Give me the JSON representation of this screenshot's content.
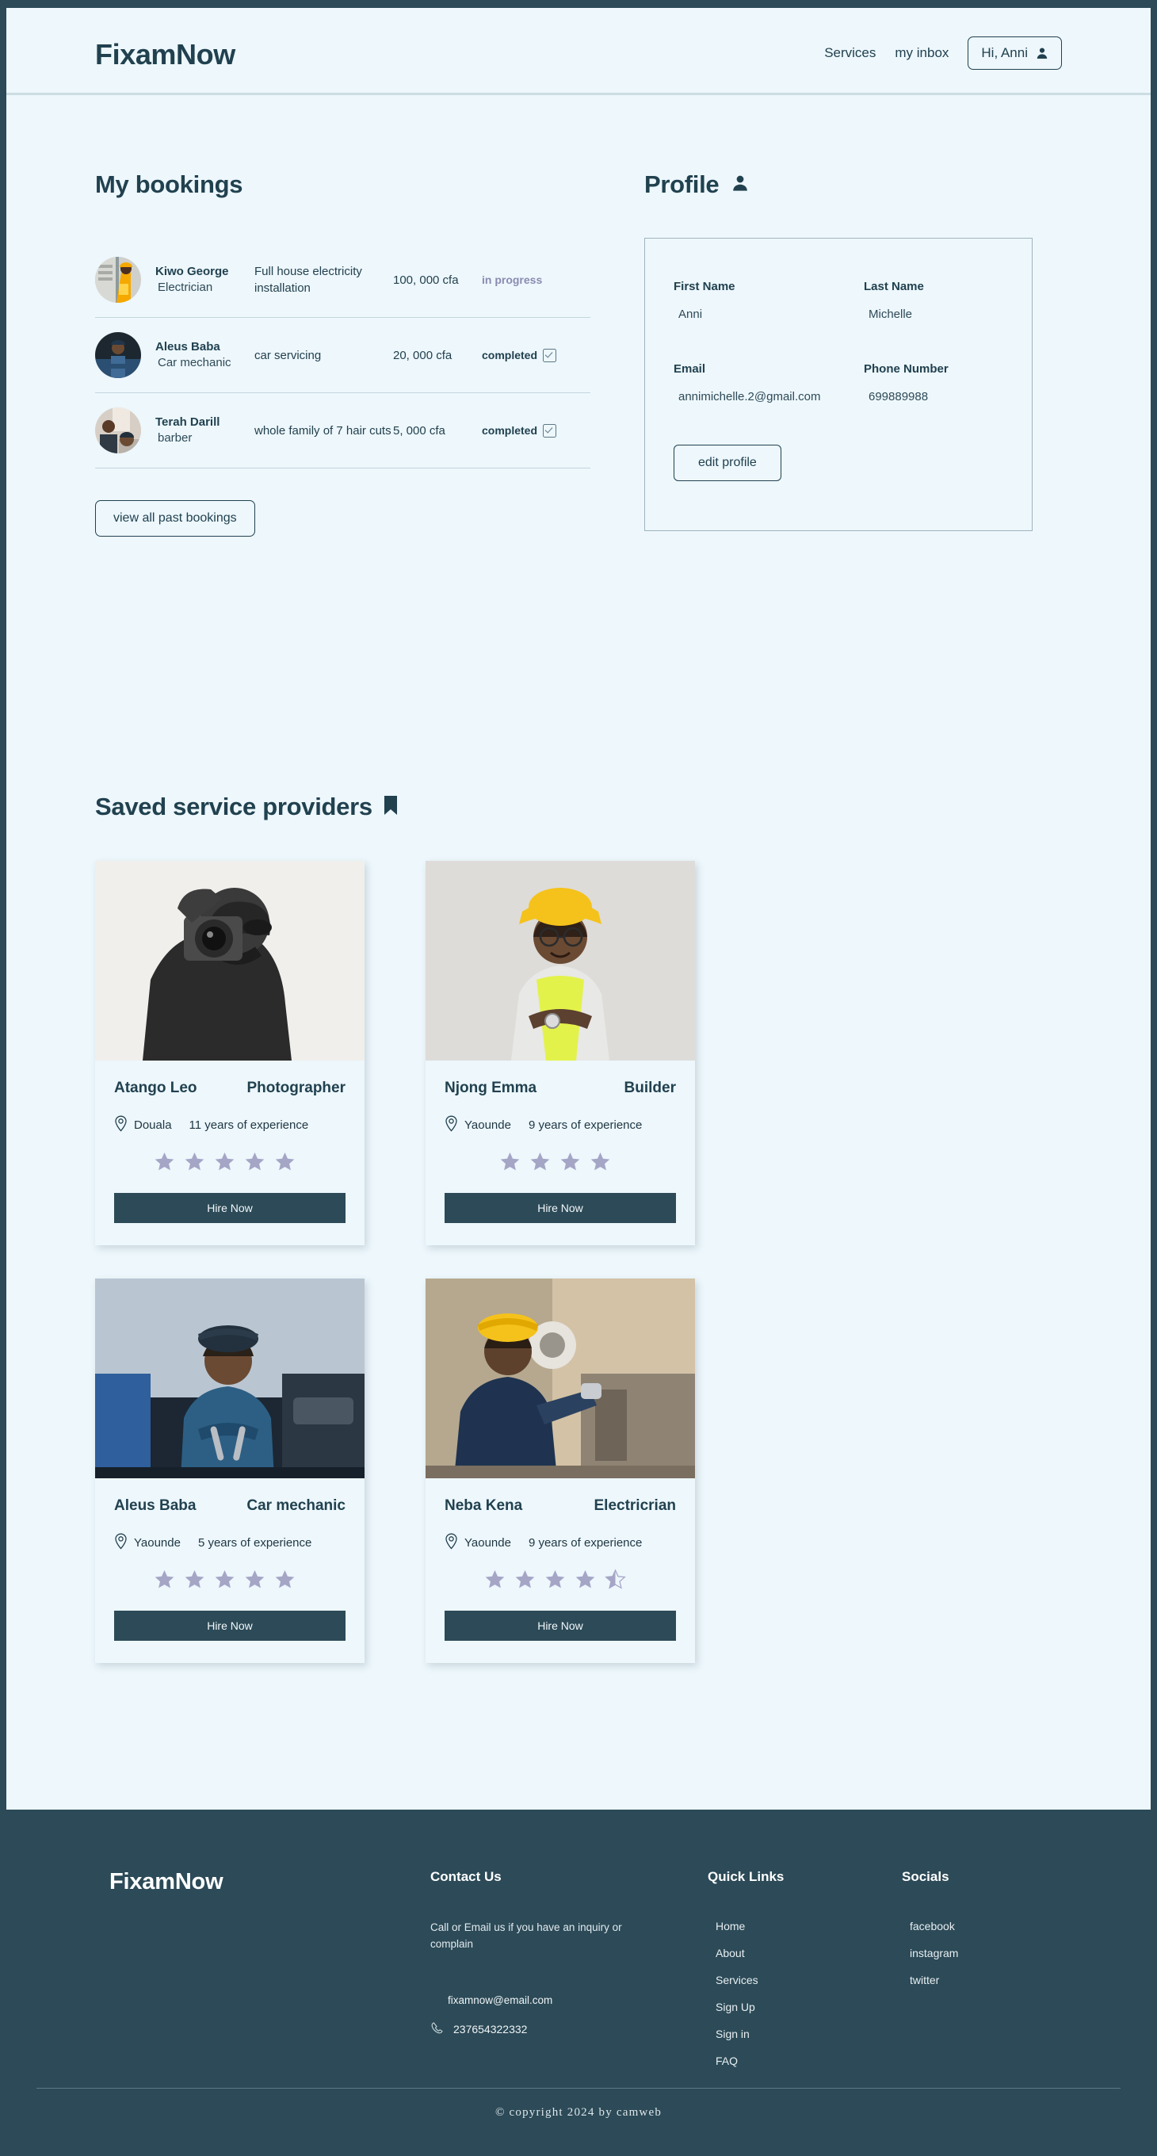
{
  "header": {
    "brand": "FixamNow",
    "nav": [
      {
        "label": "Services",
        "name": "nav-services"
      },
      {
        "label": "my inbox",
        "name": "nav-my-inbox"
      }
    ],
    "user_chip": "Hi, Anni"
  },
  "bookings": {
    "title": "My bookings",
    "rows": [
      {
        "name": "Kiwo George",
        "role": "Electrician",
        "service": "Full house electricity installation",
        "price": "100, 000 cfa",
        "status": "in progress",
        "status_type": "inprogress"
      },
      {
        "name": "Aleus Baba",
        "role": "Car mechanic",
        "service": "car servicing",
        "price": "20, 000 cfa",
        "status": "completed",
        "status_type": "completed"
      },
      {
        "name": "Terah Darill",
        "role": "barber",
        "service": "whole family of 7 hair cuts",
        "price": "5, 000 cfa",
        "status": "completed",
        "status_type": "completed"
      }
    ],
    "view_all_label": "view  all past bookings"
  },
  "profile": {
    "title": "Profile",
    "fields": {
      "first_name_label": "First Name",
      "first_name_value": "Anni",
      "last_name_label": "Last Name",
      "last_name_value": "Michelle",
      "email_label": "Email",
      "email_value": "annimichelle.2@gmail.com",
      "phone_label": "Phone Number",
      "phone_value": "699889988"
    },
    "edit_label": "edit profile"
  },
  "saved": {
    "title": "Saved  service providers",
    "cards": [
      {
        "name": "Atango Leo",
        "role": "Photographer",
        "location": "Douala",
        "experience": "11 years of experience",
        "rating": 5,
        "half": false,
        "hire_label": "Hire Now"
      },
      {
        "name": "Njong Emma",
        "role": "Builder",
        "location": "Yaounde",
        "experience": "9 years of experience",
        "rating": 4,
        "half": false,
        "hire_label": "Hire Now"
      },
      {
        "name": "Aleus Baba",
        "role": "Car mechanic",
        "location": "Yaounde",
        "experience": "5 years of experience",
        "rating": 5,
        "half": false,
        "hire_label": "Hire Now"
      },
      {
        "name": "Neba Kena",
        "role": "Electricrian",
        "location": "Yaounde",
        "experience": "9 years of experience",
        "rating": 4,
        "half": true,
        "hire_label": "Hire Now"
      }
    ]
  },
  "footer": {
    "brand": "FixamNow",
    "contact": {
      "heading": "Contact Us",
      "description": "Call or Email us if you have an inquiry or complain",
      "email": "fixamnow@email.com",
      "phone": "237654322332"
    },
    "quick_links": {
      "heading": "Quick Links",
      "items": [
        "Home",
        "About",
        "Services",
        "Sign Up",
        "Sign in",
        "FAQ"
      ]
    },
    "socials": {
      "heading": "Socials",
      "items": [
        "facebook",
        "instagram",
        "twitter"
      ]
    },
    "copyright": "© copyright 2024 by camweb"
  },
  "colors": {
    "navy": "#2C4A57",
    "page_bg": "#EDF7FC",
    "star": "#A5A5C6",
    "status_inprogress": "#8B8BB0"
  }
}
